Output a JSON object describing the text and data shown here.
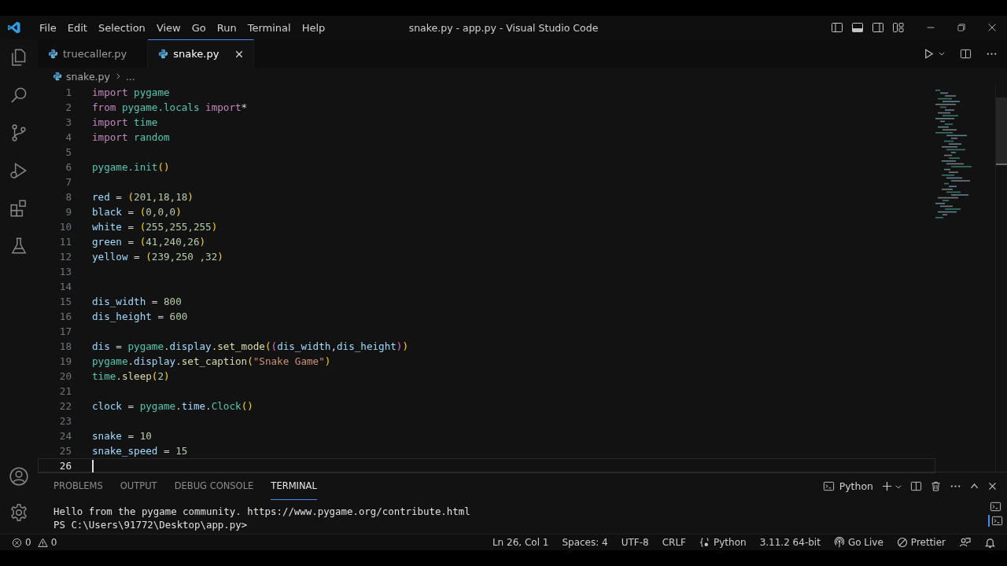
{
  "title_bar": {
    "menu": [
      "File",
      "Edit",
      "Selection",
      "View",
      "Go",
      "Run",
      "Terminal",
      "Help"
    ],
    "title": "snake.py - app.py - Visual Studio Code"
  },
  "tabs": [
    {
      "label": "truecaller.py",
      "selected": false
    },
    {
      "label": "snake.py",
      "selected": true
    }
  ],
  "breadcrumb": {
    "file": "snake.py",
    "more": "..."
  },
  "code": [
    {
      "number": "1",
      "current": false,
      "tokens": [
        {
          "text": "import ",
          "kind": "kw"
        },
        {
          "text": "pygame",
          "kind": "mod"
        }
      ]
    },
    {
      "number": "2",
      "current": false,
      "tokens": [
        {
          "text": "from ",
          "kind": "kw"
        },
        {
          "text": "pygame.locals ",
          "kind": "mod"
        },
        {
          "text": "import",
          "kind": "kw"
        },
        {
          "text": "*",
          "kind": "op"
        }
      ]
    },
    {
      "number": "3",
      "current": false,
      "tokens": [
        {
          "text": "import ",
          "kind": "kw"
        },
        {
          "text": "time",
          "kind": "mod"
        }
      ]
    },
    {
      "number": "4",
      "current": false,
      "tokens": [
        {
          "text": "import ",
          "kind": "kw"
        },
        {
          "text": "random",
          "kind": "mod"
        }
      ]
    },
    {
      "number": "5",
      "current": false
    },
    {
      "number": "6",
      "current": false,
      "tokens": [
        {
          "text": "pygame.init",
          "kind": "mod"
        },
        {
          "text": "()",
          "kind": "p1"
        }
      ]
    },
    {
      "number": "7",
      "current": false
    },
    {
      "number": "8",
      "current": false,
      "tokens": [
        {
          "text": "red",
          "kind": "var"
        },
        {
          "text": " = ",
          "kind": "op"
        },
        {
          "text": "(",
          "kind": "p1"
        },
        {
          "text": "201,18,18",
          "kind": "num"
        },
        {
          "text": ")",
          "kind": "p1"
        }
      ]
    },
    {
      "number": "9",
      "current": false,
      "tokens": [
        {
          "text": "black",
          "kind": "var"
        },
        {
          "text": " = ",
          "kind": "op"
        },
        {
          "text": "(",
          "kind": "p1"
        },
        {
          "text": "0,0,0",
          "kind": "num"
        },
        {
          "text": ")",
          "kind": "p1"
        }
      ]
    },
    {
      "number": "10",
      "current": false,
      "tokens": [
        {
          "text": "white",
          "kind": "var"
        },
        {
          "text": " = ",
          "kind": "op"
        },
        {
          "text": "(",
          "kind": "p1"
        },
        {
          "text": "255,255,255",
          "kind": "num"
        },
        {
          "text": ")",
          "kind": "p1"
        }
      ]
    },
    {
      "number": "11",
      "current": false,
      "tokens": [
        {
          "text": "green",
          "kind": "var"
        },
        {
          "text": " = ",
          "kind": "op"
        },
        {
          "text": "(",
          "kind": "p1"
        },
        {
          "text": "41,240,26",
          "kind": "num"
        },
        {
          "text": ")",
          "kind": "p1"
        }
      ]
    },
    {
      "number": "12",
      "current": false,
      "tokens": [
        {
          "text": "yellow",
          "kind": "var"
        },
        {
          "text": " = ",
          "kind": "op"
        },
        {
          "text": "(",
          "kind": "p1"
        },
        {
          "text": "239,250 ,32",
          "kind": "num"
        },
        {
          "text": ")",
          "kind": "p1"
        }
      ]
    },
    {
      "number": "13",
      "current": false
    },
    {
      "number": "14",
      "current": false
    },
    {
      "number": "15",
      "current": false,
      "tokens": [
        {
          "text": "dis_width",
          "kind": "var"
        },
        {
          "text": " = ",
          "kind": "op"
        },
        {
          "text": "800",
          "kind": "num"
        }
      ]
    },
    {
      "number": "16",
      "current": false,
      "tokens": [
        {
          "text": "dis_height",
          "kind": "var"
        },
        {
          "text": " = ",
          "kind": "op"
        },
        {
          "text": "600",
          "kind": "num"
        }
      ]
    },
    {
      "number": "17",
      "current": false
    },
    {
      "number": "18",
      "current": false,
      "tokens": [
        {
          "text": "dis",
          "kind": "var"
        },
        {
          "text": " = ",
          "kind": "op"
        },
        {
          "text": "pygame",
          "kind": "mod"
        },
        {
          "text": ".",
          "kind": "op"
        },
        {
          "text": "display",
          "kind": "var"
        },
        {
          "text": ".",
          "kind": "op"
        },
        {
          "text": "set_mode",
          "kind": "fn"
        },
        {
          "text": "(",
          "kind": "p1"
        },
        {
          "text": "(",
          "kind": "p2"
        },
        {
          "text": "dis_width",
          "kind": "var"
        },
        {
          "text": ",",
          "kind": "op"
        },
        {
          "text": "dis_height",
          "kind": "var"
        },
        {
          "text": ")",
          "kind": "p2"
        },
        {
          "text": ")",
          "kind": "p1"
        }
      ]
    },
    {
      "number": "19",
      "current": false,
      "tokens": [
        {
          "text": "pygame",
          "kind": "mod"
        },
        {
          "text": ".",
          "kind": "op"
        },
        {
          "text": "display",
          "kind": "var"
        },
        {
          "text": ".",
          "kind": "op"
        },
        {
          "text": "set_caption",
          "kind": "fn"
        },
        {
          "text": "(",
          "kind": "p1"
        },
        {
          "text": "\"Snake Game\"",
          "kind": "str"
        },
        {
          "text": ")",
          "kind": "p1"
        }
      ]
    },
    {
      "number": "20",
      "current": false,
      "tokens": [
        {
          "text": "time",
          "kind": "mod"
        },
        {
          "text": ".",
          "kind": "op"
        },
        {
          "text": "sleep",
          "kind": "fn"
        },
        {
          "text": "(",
          "kind": "p1"
        },
        {
          "text": "2",
          "kind": "num"
        },
        {
          "text": ")",
          "kind": "p1"
        }
      ]
    },
    {
      "number": "21",
      "current": false
    },
    {
      "number": "22",
      "current": false,
      "tokens": [
        {
          "text": "clock",
          "kind": "var"
        },
        {
          "text": " = ",
          "kind": "op"
        },
        {
          "text": "pygame",
          "kind": "mod"
        },
        {
          "text": ".",
          "kind": "op"
        },
        {
          "text": "time",
          "kind": "var"
        },
        {
          "text": ".",
          "kind": "op"
        },
        {
          "text": "Clock",
          "kind": "mod"
        },
        {
          "text": "()",
          "kind": "p1"
        }
      ]
    },
    {
      "number": "23",
      "current": false
    },
    {
      "number": "24",
      "current": false,
      "tokens": [
        {
          "text": "snake",
          "kind": "var"
        },
        {
          "text": " = ",
          "kind": "op"
        },
        {
          "text": "10",
          "kind": "num"
        }
      ]
    },
    {
      "number": "25",
      "current": false,
      "tokens": [
        {
          "text": "snake_speed",
          "kind": "var"
        },
        {
          "text": " = ",
          "kind": "op"
        },
        {
          "text": "15",
          "kind": "num"
        }
      ]
    },
    {
      "number": "26",
      "current": true
    }
  ],
  "panel": {
    "tabs": [
      {
        "label": "PROBLEMS",
        "selected": false
      },
      {
        "label": "OUTPUT",
        "selected": false
      },
      {
        "label": "DEBUG CONSOLE",
        "selected": false
      },
      {
        "label": "TERMINAL",
        "selected": true
      }
    ],
    "profile": "Python",
    "terminal": [
      "Hello from the pygame community. https://www.pygame.org/contribute.html",
      "PS C:\\Users\\91772\\Desktop\\app.py>"
    ]
  },
  "status_bar": {
    "left": [
      {
        "kind": "errors",
        "text": "0"
      },
      {
        "kind": "warnings",
        "text": "0"
      }
    ],
    "right": [
      {
        "kind": "plain",
        "text": "Ln 26, Col 1"
      },
      {
        "kind": "plain",
        "text": "Spaces: 4"
      },
      {
        "kind": "plain",
        "text": "UTF-8"
      },
      {
        "kind": "plain",
        "text": "CRLF"
      },
      {
        "kind": "language",
        "text": "Python"
      },
      {
        "kind": "plain",
        "text": "3.11.2 64-bit"
      },
      {
        "kind": "live",
        "text": "Go Live"
      },
      {
        "kind": "prettier",
        "text": "Prettier"
      }
    ]
  }
}
